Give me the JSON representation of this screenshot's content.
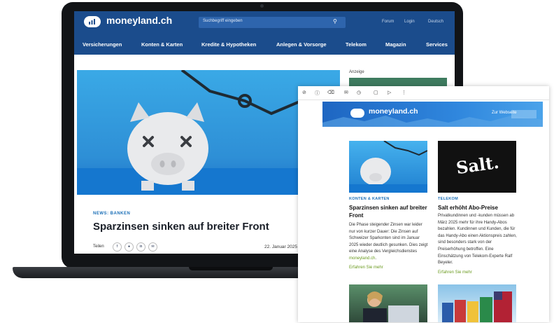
{
  "site": {
    "logo": "moneyland.ch",
    "search_placeholder": "Suchbegriff eingeben",
    "top_links": [
      "Forum",
      "Login",
      "Deutsch"
    ],
    "nav": [
      "Versicherungen",
      "Konten & Karten",
      "Kredite & Hypotheken",
      "Anlegen & Vorsorge",
      "Telekom",
      "Magazin",
      "Services"
    ],
    "ad_label": "Anzeige"
  },
  "article": {
    "kicker": "NEWS: BANKEN",
    "title": "Sparzinsen sinken auf breiter Front",
    "share_label": "Teilen",
    "share_icons": [
      "facebook-icon",
      "twitter-icon",
      "linkedin-icon",
      "email-icon"
    ],
    "date": "22. Januar 2025"
  },
  "newsletter": {
    "banner_logo": "moneyland.ch",
    "banner_link": "Zur Webseite",
    "cards": [
      {
        "category": "KONTEN & KARTEN",
        "title": "Sparzinsen sinken auf breiter Front",
        "body": "Die Phase steigender Zinsen war leider nur von kurzer Dauer: Die Zinsen auf Schweizer Sparkonten sind im Januar 2025 wieder deutlich gesunken. Dies zeigt eine Analyse des Vergleichsdienstes",
        "body_link": "moneyland.ch",
        "more": "Erfahren Sie mehr"
      },
      {
        "category": "TELEKOM",
        "title": "Salt erhöht Abo-Preise",
        "body": "Privatkundinnen und -kunden müssen ab März 2025 mehr für ihre Handy-Abos bezahlen. Kundinnen und Kunden, die für das Handy-Abo einen Aktionspreis zahlen, sind besonders stark von der Preiserhöhung betroffen. Eine Einschätzung von Telekom-Experte Ralf Beyeler.",
        "more": "Erfahren Sie mehr",
        "image_text": "Salt."
      }
    ]
  }
}
